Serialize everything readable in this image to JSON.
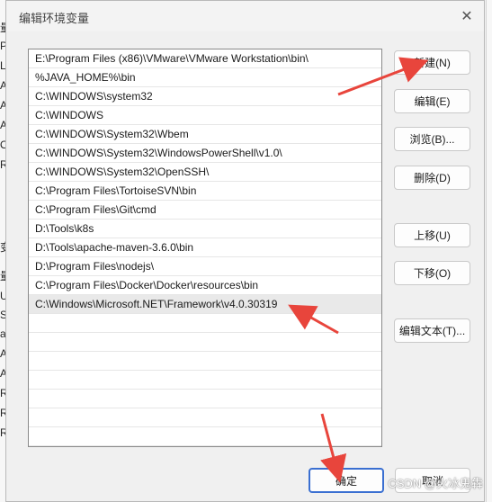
{
  "dialog": {
    "title": "编辑环境变量",
    "close_glyph": "✕"
  },
  "path_entries": [
    "E:\\Program Files (x86)\\VMware\\VMware Workstation\\bin\\",
    "%JAVA_HOME%\\bin",
    "C:\\WINDOWS\\system32",
    "C:\\WINDOWS",
    "C:\\WINDOWS\\System32\\Wbem",
    "C:\\WINDOWS\\System32\\WindowsPowerShell\\v1.0\\",
    "C:\\WINDOWS\\System32\\OpenSSH\\",
    "C:\\Program Files\\TortoiseSVN\\bin",
    "C:\\Program Files\\Git\\cmd",
    "D:\\Tools\\k8s",
    "D:\\Tools\\apache-maven-3.6.0\\bin",
    "D:\\Program Files\\nodejs\\",
    "C:\\Program Files\\Docker\\Docker\\resources\\bin",
    "C:\\Windows\\Microsoft.NET\\Framework\\v4.0.30319"
  ],
  "buttons": {
    "new": "新建(N)",
    "edit": "编辑(E)",
    "browse": "浏览(B)...",
    "delete": "删除(D)",
    "move_up": "上移(U)",
    "move_down": "下移(O)",
    "edit_text": "编辑文本(T)...",
    "ok": "确定",
    "cancel": "取消"
  },
  "background_window_fragments": [
    "量",
    "PP",
    "LIC",
    "AT",
    "AT",
    "AT",
    "OL",
    "RA",
    "变",
    "量",
    "UN",
    "S",
    "ath",
    "AT",
    "AT",
    "RO",
    "RO",
    "RO"
  ],
  "watermark": "CSDN @火冰鬼犇",
  "annotation_color": "#e8453c"
}
